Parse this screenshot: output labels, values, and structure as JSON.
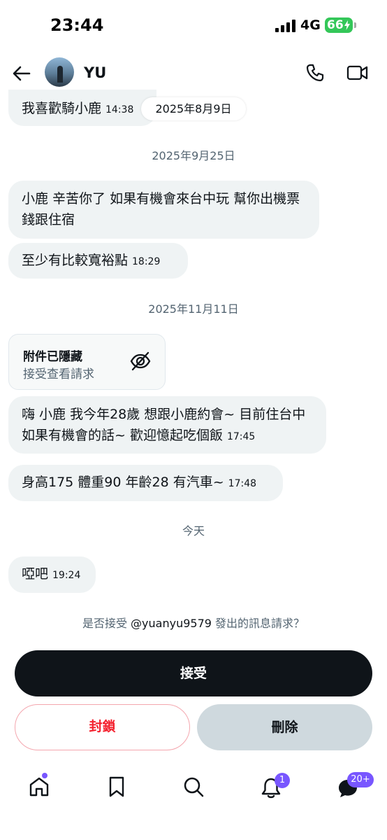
{
  "status_bar": {
    "time": "23:44",
    "network": "4G",
    "battery": "66"
  },
  "header": {
    "contact_name": "YU"
  },
  "messages": [
    {
      "text": "我喜歡騎小鹿",
      "time": "14:38"
    },
    {
      "text": "小鹿 辛苦你了 如果有機會來台中玩 幫你出機票錢跟住宿",
      "time": ""
    },
    {
      "text": "至少有比較寬裕點",
      "time": "18:29"
    },
    {
      "text": "嗨 小鹿 我今年28歲 想跟小鹿約會~ 目前住台中 如果有機會的話~ 歡迎憶起吃個飯",
      "time": "17:45"
    },
    {
      "text": "身高175 體重90 年齡28 有汽車~",
      "time": "17:48"
    },
    {
      "text": "啞吧",
      "time": "19:24"
    }
  ],
  "dates": {
    "pill": "2025年8月9日",
    "d1": "2025年9月25日",
    "d2": "2025年11月11日",
    "d3": "今天"
  },
  "attachment": {
    "title": "附件已隱藏",
    "link": "接受查看請求"
  },
  "request": {
    "prefix": "是否接受 ",
    "handle": "@yuanyu9579",
    "suffix": " 發出的訊息請求？"
  },
  "actions": {
    "accept": "接受",
    "block": "封鎖",
    "delete": "刪除"
  },
  "bottom_nav": {
    "notifications_badge": "1",
    "messages_badge": "20+",
    "accent_color": "#7856ff"
  }
}
